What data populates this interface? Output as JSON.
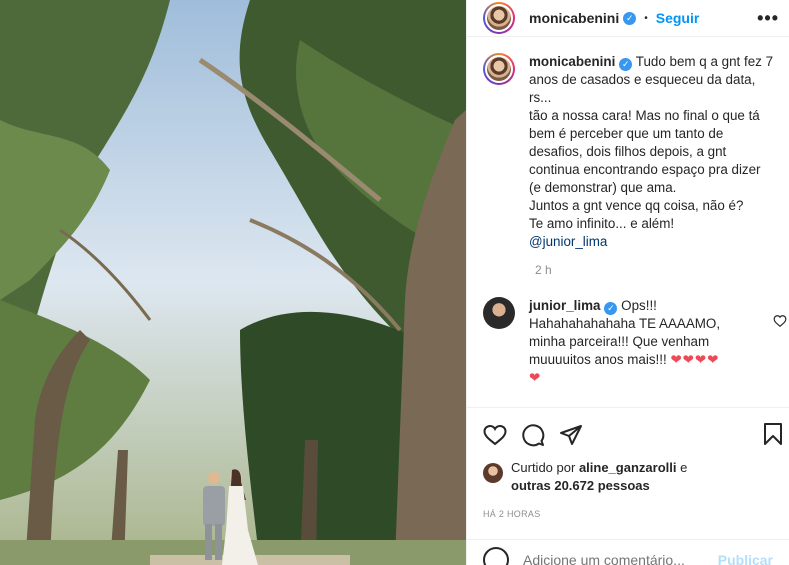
{
  "post": {
    "author": "monicabenini",
    "follow_label": "Seguir",
    "dot": "•",
    "more_label": "•••",
    "caption_author": "monicabenini",
    "caption_lines": [
      "Tudo bem q a gnt fez 7",
      "anos de casados e esqueceu da data, rs...",
      "tão a nossa cara! Mas no final o que tá",
      "bem é perceber que um tanto de",
      "desafios, dois filhos depois, a gnt",
      "continua encontrando espaço pra dizer",
      "(e demonstrar) que ama.",
      "Juntos a gnt vence qq coisa, não é?",
      "Te amo infinito... e além!"
    ],
    "mention": "@junior_lima",
    "caption_time": "2 h"
  },
  "comment": {
    "author": "junior_lima",
    "lines": [
      "Ops!!!",
      "Hahahahahahaha TE AAAAMO,",
      "minha parceira!!! Que venham",
      "muuuuitos anos mais!!!"
    ],
    "hearts": "❤❤❤❤",
    "heart_last": "❤"
  },
  "likes": {
    "prefix": "Curtido por",
    "user": "aline_ganzarolli",
    "joiner": "e",
    "others": "outras 20.672 pessoas"
  },
  "post_time": "HÁ 2 HORAS",
  "add_comment": {
    "placeholder": "Adicione um comentário...",
    "publish_label": "Publicar"
  },
  "colors": {
    "accent": "#0095f6",
    "heart": "#ed4956",
    "muted": "#8e8e8e"
  }
}
